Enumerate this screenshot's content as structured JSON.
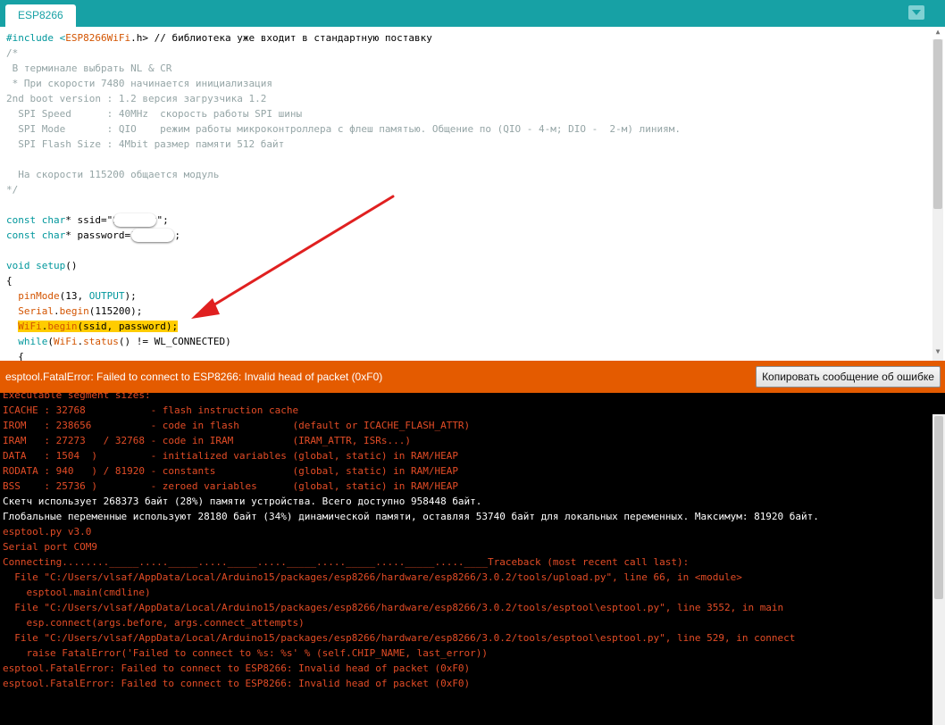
{
  "tab": {
    "label": "ESP8266"
  },
  "code_lines": [
    [
      {
        "t": "#include <",
        "c": "kw"
      },
      {
        "t": "ESP8266WiFi",
        "c": "fn"
      },
      {
        "t": ".h> // библиотека уже входит в стандартную поставку",
        "c": "kw2"
      }
    ],
    [
      {
        "t": "/*",
        "c": "cm"
      }
    ],
    [
      {
        "t": " В терминале выбрать NL & CR",
        "c": "cm"
      }
    ],
    [
      {
        "t": " * При скорости 7480 начинается инициализация",
        "c": "cm"
      }
    ],
    [
      {
        "t": "2nd boot version : 1.2 версия загрузчика 1.2",
        "c": "cm"
      }
    ],
    [
      {
        "t": "  SPI Speed      : 40MHz  скорость работы SPI шины",
        "c": "cm"
      }
    ],
    [
      {
        "t": "  SPI Mode       : QIO    режим работы микроконтроллера с флеш памятью. Общение по (QIO - 4-м; DIO -  2-м) линиям.",
        "c": "cm"
      }
    ],
    [
      {
        "t": "  SPI Flash Size : 4Mbit размер памяти 512 байт",
        "c": "cm"
      }
    ],
    [
      {
        "t": "",
        "c": "cm"
      }
    ],
    [
      {
        "t": "  На скорости 115200 общается модуль",
        "c": "cm"
      }
    ],
    [
      {
        "t": "*/",
        "c": "cm"
      }
    ],
    [
      {
        "t": "",
        "c": ""
      }
    ],
    [
      {
        "t": "const",
        "c": "kw"
      },
      {
        "t": " ",
        "c": ""
      },
      {
        "t": "char",
        "c": "kw"
      },
      {
        "t": "* ssid=\"S",
        "c": ""
      },
      {
        "t": "",
        "c": "blob"
      },
      {
        "t": "v\";",
        "c": ""
      }
    ],
    [
      {
        "t": "const",
        "c": "kw"
      },
      {
        "t": " ",
        "c": ""
      },
      {
        "t": "char",
        "c": "kw"
      },
      {
        "t": "* password=\"",
        "c": ""
      },
      {
        "t": "",
        "c": "blob"
      },
      {
        "t": "\";",
        "c": ""
      }
    ],
    [
      {
        "t": "",
        "c": ""
      }
    ],
    [
      {
        "t": "void",
        "c": "kw"
      },
      {
        "t": " ",
        "c": ""
      },
      {
        "t": "setup",
        "c": "kw"
      },
      {
        "t": "()",
        "c": ""
      }
    ],
    [
      {
        "t": "{",
        "c": ""
      }
    ],
    [
      {
        "t": "  ",
        "c": ""
      },
      {
        "t": "pinMode",
        "c": "fn"
      },
      {
        "t": "(13, ",
        "c": ""
      },
      {
        "t": "OUTPUT",
        "c": "kw"
      },
      {
        "t": ");",
        "c": ""
      }
    ],
    [
      {
        "t": "  ",
        "c": ""
      },
      {
        "t": "Serial",
        "c": "fn"
      },
      {
        "t": ".",
        "c": ""
      },
      {
        "t": "begin",
        "c": "fn"
      },
      {
        "t": "(115200);",
        "c": ""
      }
    ],
    [
      {
        "t": "  ",
        "c": ""
      },
      {
        "t": "WiFi",
        "c": "fnhl"
      },
      {
        "t": ".",
        "c": "hl"
      },
      {
        "t": "begin",
        "c": "fnhl"
      },
      {
        "t": "(ssid, password);",
        "c": "hl"
      }
    ],
    [
      {
        "t": "  ",
        "c": ""
      },
      {
        "t": "while",
        "c": "kw"
      },
      {
        "t": "(",
        "c": ""
      },
      {
        "t": "WiFi",
        "c": "fn"
      },
      {
        "t": ".",
        "c": ""
      },
      {
        "t": "status",
        "c": "fn"
      },
      {
        "t": "() != WL_CONNECTED)",
        "c": ""
      }
    ],
    [
      {
        "t": "  {",
        "c": ""
      }
    ]
  ],
  "status": {
    "message": "esptool.FatalError: Failed to connect to ESP8266: Invalid head of packet (0xF0)",
    "copy_button": "Копировать сообщение об ошибке"
  },
  "console_lines": [
    {
      "t": "Executable segment sizes:",
      "c": "err"
    },
    {
      "t": "ICACHE : 32768           - flash instruction cache",
      "c": "err"
    },
    {
      "t": "IROM   : 238656          - code in flash         (default or ICACHE_FLASH_ATTR)",
      "c": "err"
    },
    {
      "t": "IRAM   : 27273   / 32768 - code in IRAM          (IRAM_ATTR, ISRs...)",
      "c": "err"
    },
    {
      "t": "DATA   : 1504  )         - initialized variables (global, static) in RAM/HEAP",
      "c": "err"
    },
    {
      "t": "RODATA : 940   ) / 81920 - constants             (global, static) in RAM/HEAP",
      "c": "err"
    },
    {
      "t": "BSS    : 25736 )         - zeroed variables      (global, static) in RAM/HEAP",
      "c": "err"
    },
    {
      "t": "Скетч использует 268373 байт (28%) памяти устройства. Всего доступно 958448 байт.",
      "c": "wht"
    },
    {
      "t": "Глобальные переменные используют 28180 байт (34%) динамической памяти, оставляя 53740 байт для локальных переменных. Максимум: 81920 байт.",
      "c": "wht"
    },
    {
      "t": "esptool.py v3.0",
      "c": "err"
    },
    {
      "t": "Serial port COM9",
      "c": "err"
    },
    {
      "t": "Connecting........_____....._____....._____....._____....._____....._____.....____Traceback (most recent call last):",
      "c": "err"
    },
    {
      "t": "  File \"C:/Users/vlsaf/AppData/Local/Arduino15/packages/esp8266/hardware/esp8266/3.0.2/tools/upload.py\", line 66, in <module>",
      "c": "err"
    },
    {
      "t": "    esptool.main(cmdline)",
      "c": "err"
    },
    {
      "t": "  File \"C:/Users/vlsaf/AppData/Local/Arduino15/packages/esp8266/hardware/esp8266/3.0.2/tools/esptool\\esptool.py\", line 3552, in main",
      "c": "err"
    },
    {
      "t": "    esp.connect(args.before, args.connect_attempts)",
      "c": "err"
    },
    {
      "t": "  File \"C:/Users/vlsaf/AppData/Local/Arduino15/packages/esp8266/hardware/esp8266/3.0.2/tools/esptool\\esptool.py\", line 529, in connect",
      "c": "err"
    },
    {
      "t": "    raise FatalError('Failed to connect to %s: %s' % (self.CHIP_NAME, last_error))",
      "c": "err"
    },
    {
      "t": "esptool.FatalError: Failed to connect to ESP8266: Invalid head of packet (0xF0)",
      "c": "err"
    },
    {
      "t": "esptool.FatalError: Failed to connect to ESP8266: Invalid head of packet (0xF0)",
      "c": "err"
    },
    {
      "t": "",
      "c": "err"
    },
    {
      "t": "",
      "c": "err"
    },
    {
      "t": "_",
      "c": "err"
    }
  ],
  "icons": {
    "tab_menu": "dropdown-triangle-icon",
    "arrow": "red-annotation-arrow"
  },
  "colors": {
    "accent": "#17a1a5",
    "error_bar": "#e45b00",
    "console_bg": "#000000",
    "highlight": "#ffcc00",
    "arrow": "#e02020"
  }
}
